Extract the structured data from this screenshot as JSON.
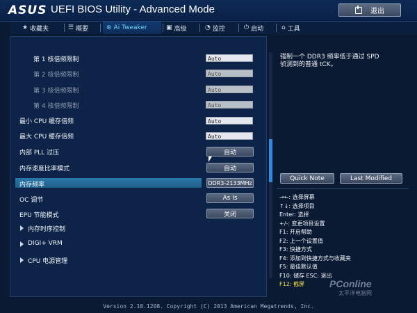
{
  "header": {
    "brand": "ASUS",
    "title": "UEFI BIOS Utility - Advanced Mode",
    "exit_label": "退出"
  },
  "tabs": [
    {
      "label": "收藏夹",
      "icon": "star-icon"
    },
    {
      "label": "概要",
      "icon": "list-icon"
    },
    {
      "label": "Ai Tweaker",
      "icon": "ai-tweaker-icon",
      "active": true
    },
    {
      "label": "高级",
      "icon": "advanced-icon"
    },
    {
      "label": "监控",
      "icon": "monitor-icon"
    },
    {
      "label": "启动",
      "icon": "power-icon"
    },
    {
      "label": "工具",
      "icon": "tool-icon"
    }
  ],
  "settings": [
    {
      "label": "第 1 核倍频限制",
      "value": "Auto",
      "kind": "input",
      "dim_label": false,
      "dim_value": false
    },
    {
      "label": "第 2 核倍频限制",
      "value": "Auto",
      "kind": "input",
      "dim_label": true,
      "dim_value": true
    },
    {
      "label": "第 3 核倍频限制",
      "value": "Auto",
      "kind": "input",
      "dim_label": true,
      "dim_value": true
    },
    {
      "label": "第 4 核倍频限制",
      "value": "Auto",
      "kind": "input",
      "dim_label": true,
      "dim_value": true
    },
    {
      "label": "最小 CPU 缓存倍频",
      "value": "Auto",
      "kind": "input",
      "dim_label": false,
      "dim_value": false
    },
    {
      "label": "最大 CPU 缓存倍频",
      "value": "Auto",
      "kind": "input",
      "dim_label": false,
      "dim_value": false
    },
    {
      "label": "内部 PLL 过压",
      "value": "自动",
      "kind": "button"
    },
    {
      "label": "内存速度比率模式",
      "value": "自动",
      "kind": "button"
    },
    {
      "label": "内存频率",
      "value": "DDR3-2133MHz",
      "kind": "button",
      "selected": true
    },
    {
      "label": "OC 调节",
      "value": "As Is",
      "kind": "button"
    },
    {
      "label": "EPU 节能模式",
      "value": "关闭",
      "kind": "button"
    }
  ],
  "submenus": [
    {
      "label": "内存时序控制"
    },
    {
      "label": "DIGI+ VRM"
    },
    {
      "label": "CPU 电源管理"
    }
  ],
  "help": {
    "line1": "强制一个 DDR3 频率低于通过 SPD",
    "line2": "侦测到的普通 tCK。"
  },
  "right_buttons": {
    "quick_note": "Quick Note",
    "last_modified": "Last Modified"
  },
  "keys": [
    {
      "text": "→←: 选择屏幕",
      "highlight": false
    },
    {
      "text": "↑↓: 选择项目",
      "highlight": false
    },
    {
      "text": "Enter: 选择",
      "highlight": false
    },
    {
      "text": "+/-: 变更项目设置",
      "highlight": false
    },
    {
      "text": "F1: 开启帮助",
      "highlight": false
    },
    {
      "text": "F2: 上一个设置值",
      "highlight": false
    },
    {
      "text": "F3: 快捷方式",
      "highlight": false
    },
    {
      "text": "F4: 添加到快捷方式与收藏夹",
      "highlight": false
    },
    {
      "text": "F5: 最佳默认值",
      "highlight": false
    },
    {
      "text": "F10: 储存  ESC: 退出",
      "highlight": false
    },
    {
      "text": "F12: 截屏",
      "highlight": true
    }
  ],
  "footer": "Version 2.10.1208. Copyright (C) 2013 American Megatrends, Inc.",
  "watermark": {
    "main": "PConline",
    "sub": "太平洋电脑网"
  },
  "colors": {
    "background": "#0b1a33",
    "accent": "#2c8ce0",
    "selected_row": "#2a78a8",
    "active_tab": "#6fd1ff",
    "highlight_key": "#f2e04a"
  }
}
